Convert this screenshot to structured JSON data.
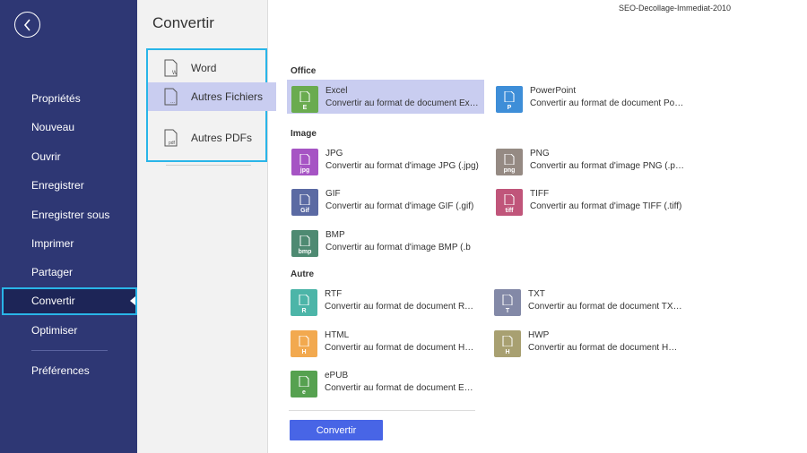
{
  "document_title": "SEO-Decollage-Immediat-2010",
  "nav": {
    "items": [
      {
        "label": "Propriétés"
      },
      {
        "label": "Nouveau"
      },
      {
        "label": "Ouvrir"
      },
      {
        "label": "Enregistrer"
      },
      {
        "label": "Enregistrer sous"
      },
      {
        "label": "Imprimer"
      },
      {
        "label": "Partager"
      },
      {
        "label": "Convertir",
        "active": true
      },
      {
        "label": "Optimiser"
      },
      {
        "label": "Préférences"
      }
    ]
  },
  "convert_panel": {
    "title": "Convertir",
    "items": [
      {
        "label": "Word",
        "icon_ext": "W"
      },
      {
        "label": "Autres Fichiers",
        "icon_ext": "...",
        "active": true
      },
      {
        "label": "Autres PDFs",
        "icon_ext": "pdf"
      }
    ]
  },
  "sections": {
    "office": {
      "title": "Office",
      "items": [
        {
          "name": "Excel",
          "desc": "Convertir au format de document Excel",
          "ext": "E",
          "color": "#6aab4f",
          "selected": true
        },
        {
          "name": "PowerPoint",
          "desc": "Convertir au format de document PowerPoint",
          "ext": "P",
          "color": "#3e8ed8"
        }
      ]
    },
    "image": {
      "title": "Image",
      "items": [
        {
          "name": "JPG",
          "desc": "Convertir au format d'image JPG (.jpg)",
          "ext": "jpg",
          "color": "#a654c4"
        },
        {
          "name": "PNG",
          "desc": "Convertir au format d'image PNG (.png)",
          "ext": "png",
          "color": "#958a83"
        },
        {
          "name": "GIF",
          "desc": "Convertir au format d'image GIF (.gif)",
          "ext": "Gif",
          "color": "#5b6aa3"
        },
        {
          "name": "TIFF",
          "desc": "Convertir au format d'image TIFF (.tiff)",
          "ext": "tiff",
          "color": "#c0557a"
        },
        {
          "name": "BMP",
          "desc": "Convertir au format d'image BMP (.b",
          "ext": "bmp",
          "color": "#4e8a72"
        }
      ]
    },
    "other": {
      "title": "Autre",
      "items": [
        {
          "name": "RTF",
          "desc": "Convertir au format de document RTF (.rtf)",
          "ext": "R",
          "color": "#4cb5a8"
        },
        {
          "name": "TXT",
          "desc": "Convertir au format de document TXT (.txt)",
          "ext": "T",
          "color": "#8389a7"
        },
        {
          "name": "HTML",
          "desc": "Convertir au format de document HTML",
          "ext": "H",
          "color": "#f2a94f"
        },
        {
          "name": "HWP",
          "desc": "Convertir au format de document HWP",
          "ext": "H",
          "color": "#a8a071"
        },
        {
          "name": "ePUB",
          "desc": "Convertir au format de document EPUB",
          "ext": "e",
          "color": "#56a150"
        }
      ]
    }
  },
  "convert_button": {
    "label": "Convertir",
    "color": "#4865e6"
  },
  "accent_color": "#29b5e8",
  "nav_bg_color": "#2e3774"
}
